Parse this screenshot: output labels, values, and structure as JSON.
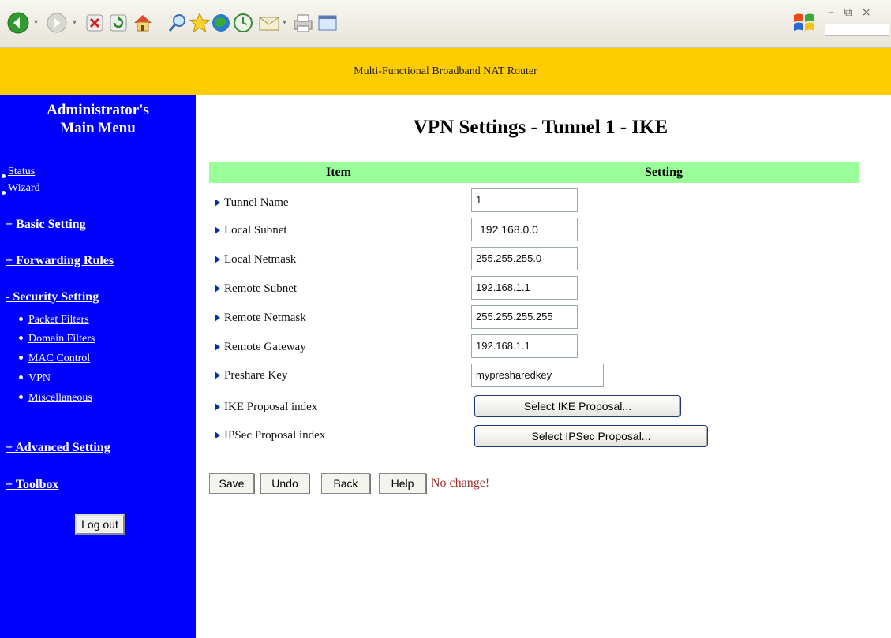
{
  "browser_toolbar": {
    "icons": [
      "back-icon",
      "forward-icon",
      "stop-icon",
      "refresh-icon",
      "home-icon",
      "search-icon",
      "favorites-icon",
      "media-icon",
      "history-icon",
      "mail-icon",
      "print-icon",
      "edit-icon"
    ],
    "window_controls": "– ⧉ ×"
  },
  "banner": {
    "title": "Multi-Functional Broadband NAT Router"
  },
  "sidebar": {
    "title_line1": "Administrator's",
    "title_line2": "Main Menu",
    "status": "Status",
    "wizard": "Wizard",
    "basic_setting": "+ Basic Setting",
    "forwarding_rules": "+ Forwarding Rules",
    "security_setting": "- Security Setting",
    "sub_items": [
      "Packet Filters",
      "Domain Filters",
      "MAC Control",
      "VPN",
      "Miscellaneous"
    ],
    "advanced_setting": "+ Advanced Setting",
    "toolbox": "+ Toolbox",
    "logout": "Log out"
  },
  "main": {
    "title": "VPN Settings - Tunnel 1 - IKE",
    "col_item": "Item",
    "col_setting": "Setting",
    "rows": [
      {
        "label": "Tunnel Name",
        "value": "1"
      },
      {
        "label": "Local Subnet",
        "value": "192.168.0.0"
      },
      {
        "label": "Local Netmask",
        "value": "255.255.255.0"
      },
      {
        "label": "Remote Subnet",
        "value": "192.168.1.1"
      },
      {
        "label": "Remote Netmask",
        "value": "255.255.255.255"
      },
      {
        "label": "Remote Gateway",
        "value": "192.168.1.1"
      },
      {
        "label": "Preshare Key",
        "value": "mypresharedkey"
      },
      {
        "label": "IKE Proposal index",
        "button": "Select IKE Proposal..."
      },
      {
        "label": "IPSec Proposal index",
        "button": "Select IPSec Proposal..."
      }
    ],
    "buttons": {
      "save": "Save",
      "undo": "Undo",
      "back": "Back",
      "help": "Help"
    },
    "status": "No change!"
  }
}
